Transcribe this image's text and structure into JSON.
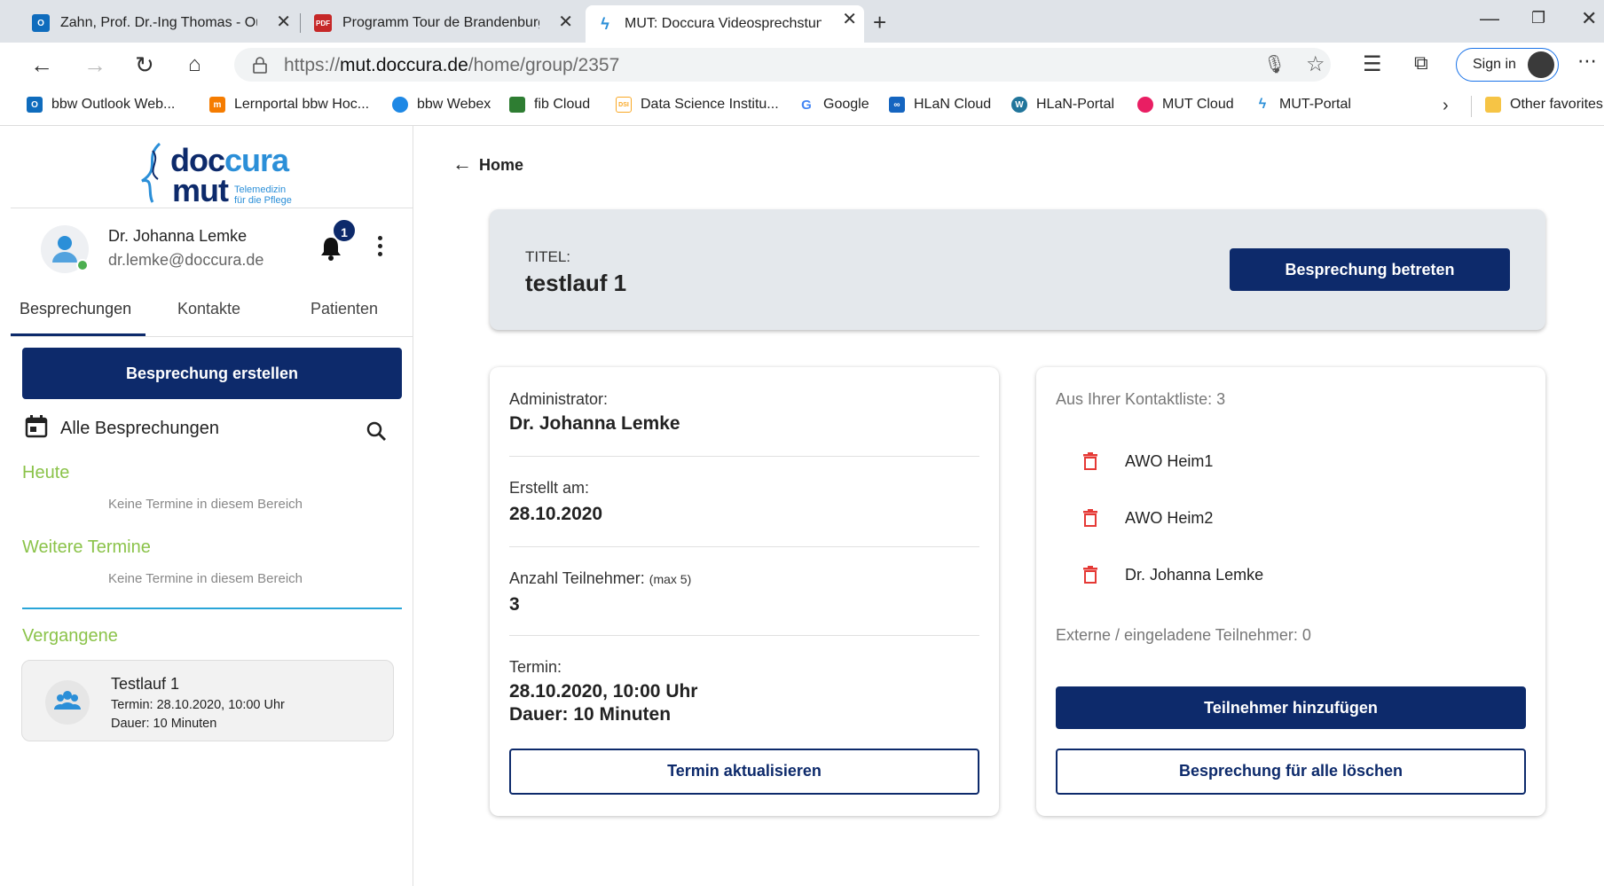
{
  "browser": {
    "tabs": [
      {
        "title": "Zahn, Prof. Dr.-Ing Thomas - Out",
        "icon": "outlook-icon",
        "color": "#0f6cbd",
        "glyph": "O"
      },
      {
        "title": "Programm Tour de Brandenburg",
        "icon": "pdf-icon",
        "color": "#c62828",
        "glyph": "PDF"
      },
      {
        "title": "MUT: Doccura Videosprechstund",
        "icon": "doccura-icon",
        "color": "#2b8fd8",
        "glyph": ""
      }
    ],
    "url_prefix": "https://",
    "url_domain": "mut.doccura.de",
    "url_path": "/home/group/2357",
    "sign_in": "Sign in",
    "bookmarks": [
      {
        "label": "bbw Outlook Web...",
        "color": "#0f6cbd",
        "glyph": "O"
      },
      {
        "label": "Lernportal bbw Hoc...",
        "color": "#f57c00",
        "glyph": "m"
      },
      {
        "label": "bbw Webex",
        "color": "#1e88e5",
        "glyph": ""
      },
      {
        "label": "fib Cloud",
        "color": "#2e7d32",
        "glyph": ""
      },
      {
        "label": "Data Science Institu...",
        "color": "#f9a825",
        "glyph": "DSI"
      },
      {
        "label": "Google",
        "color": "#4285f4",
        "glyph": "G"
      },
      {
        "label": "HLaN Cloud",
        "color": "#1565c0",
        "glyph": "∞"
      },
      {
        "label": "HLaN-Portal",
        "color": "#21759b",
        "glyph": "W"
      },
      {
        "label": "MUT Cloud",
        "color": "#e91e63",
        "glyph": ""
      },
      {
        "label": "MUT-Portal",
        "color": "#2b8fd8",
        "glyph": ""
      }
    ],
    "other_favorites": "Other favorites"
  },
  "logo": {
    "line1a": "doc",
    "line1b": "cura",
    "line2": "mut",
    "tag1": "Telemedizin",
    "tag2": "für die Pflege"
  },
  "user": {
    "name": "Dr. Johanna Lemke",
    "email": "dr.lemke@doccura.de",
    "notifications": "1"
  },
  "sidebar": {
    "tabs": [
      "Besprechungen",
      "Kontakte",
      "Patienten"
    ],
    "create_button": "Besprechung erstellen",
    "all_meetings": "Alle Besprechungen",
    "today": "Heute",
    "today_empty": "Keine Termine in diesem Bereich",
    "upcoming": "Weitere Termine",
    "upcoming_empty": "Keine Termine in diesem Bereich",
    "past": "Vergangene",
    "past_item": {
      "title": "Testlauf 1",
      "date": "Termin: 28.10.2020, 10:00 Uhr",
      "duration": "Dauer: 10 Minuten"
    }
  },
  "main": {
    "back": "Home",
    "title_label": "TITEL:",
    "title": "testlauf 1",
    "join_button": "Besprechung betreten",
    "details": {
      "admin_label": "Administrator:",
      "admin": "Dr. Johanna Lemke",
      "created_label": "Erstellt am:",
      "created": "28.10.2020",
      "participants_label": "Anzahl Teilnehmer:",
      "participants_max": "(max 5)",
      "participants": "3",
      "date_label": "Termin:",
      "date": "28.10.2020, 10:00 Uhr",
      "duration": "Dauer: 10 Minuten",
      "update_button": "Termin aktualisieren"
    },
    "contacts": {
      "heading": "Aus Ihrer Kontaktliste: 3",
      "list": [
        "AWO Heim1",
        "AWO Heim2",
        "Dr. Johanna Lemke"
      ],
      "external": "Externe / eingeladene Teilnehmer: 0",
      "add_button": "Teilnehmer hinzufügen",
      "delete_button": "Besprechung für alle löschen"
    }
  }
}
